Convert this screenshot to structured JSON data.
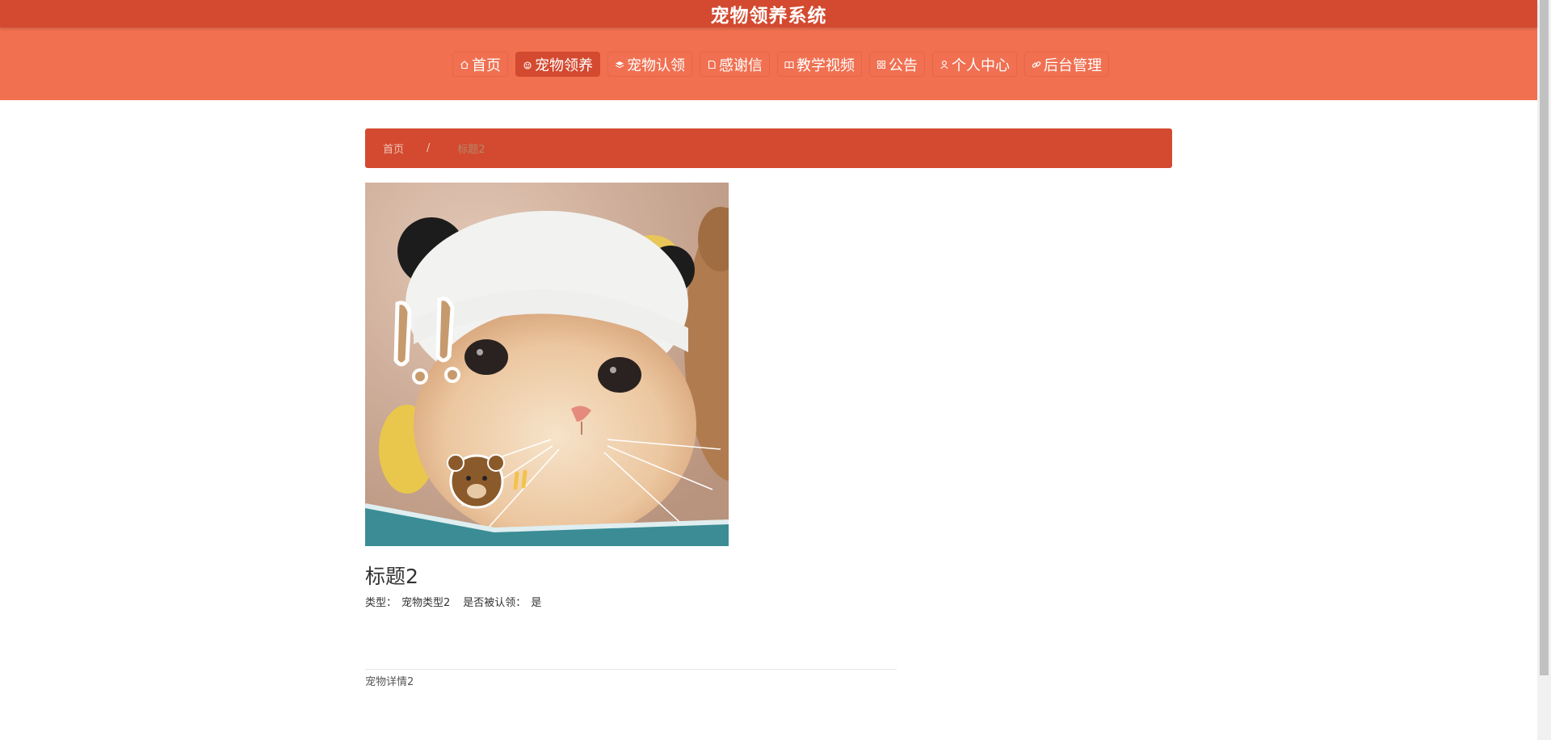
{
  "header": {
    "site_title": "宠物领养系统"
  },
  "nav": {
    "items": [
      {
        "label": "首页",
        "icon": "home-icon",
        "active": false
      },
      {
        "label": "宠物领养",
        "icon": "paw-icon",
        "active": true
      },
      {
        "label": "宠物认领",
        "icon": "layers-icon",
        "active": false
      },
      {
        "label": "感谢信",
        "icon": "document-icon",
        "active": false
      },
      {
        "label": "教学视频",
        "icon": "book-icon",
        "active": false
      },
      {
        "label": "公告",
        "icon": "grid-icon",
        "active": false
      },
      {
        "label": "个人中心",
        "icon": "user-icon",
        "active": false
      },
      {
        "label": "后台管理",
        "icon": "link-icon",
        "active": false
      }
    ]
  },
  "breadcrumb": {
    "home": "首页",
    "separator": "/",
    "current": "标题2"
  },
  "pet": {
    "title": "标题2",
    "type_label": "类型：",
    "type_value": "宠物类型2",
    "claimed_label": "是否被认领：",
    "claimed_value": "是",
    "detail": "宠物详情2",
    "image_alt": "cat-photo"
  },
  "colors": {
    "topbar": "#d34a30",
    "navbar": "#f1704f",
    "active_nav": "#d34a30",
    "breadcrumb_bar": "#d34a30"
  }
}
